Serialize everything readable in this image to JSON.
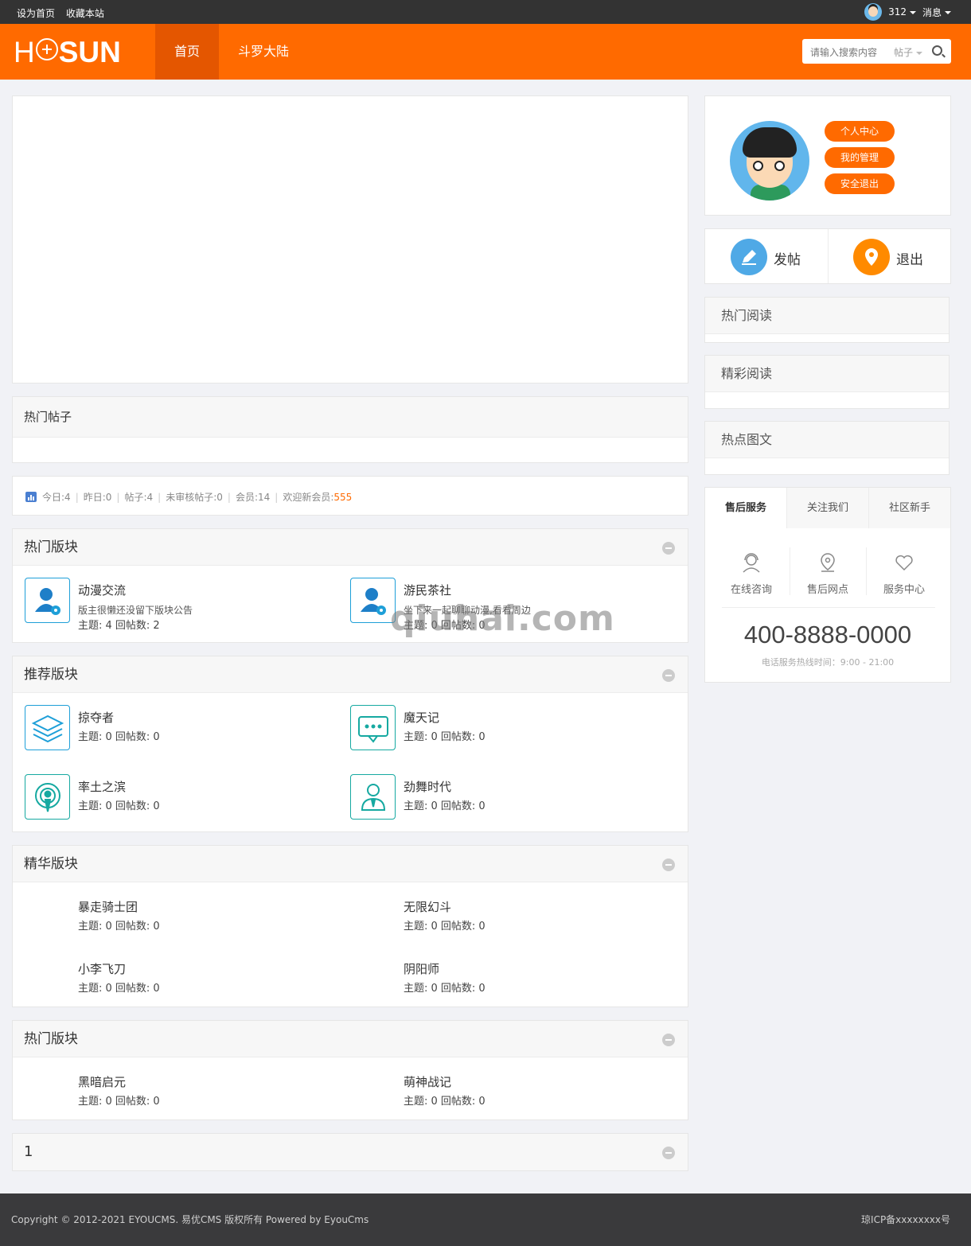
{
  "topbar": {
    "set_home": "设为首页",
    "bookmark": "收藏本站",
    "points": "312",
    "messages": "消息"
  },
  "header": {
    "logo_left": "H",
    "logo_right": "SUN",
    "nav": [
      "首页",
      "斗罗大陆"
    ],
    "search_placeholder": "请输入搜索内容",
    "search_type": "帖子"
  },
  "main": {
    "hot_posts_title": "热门帖子",
    "stats": {
      "today_label": "今日:",
      "today": "4",
      "yesterday_label": "昨日:",
      "yesterday": "0",
      "posts_label": "帖子:",
      "posts": "4",
      "pending_label": "未审核帖子:",
      "pending": "0",
      "members_label": "会员:",
      "members": "14",
      "welcome_label": "欢迎新会员:",
      "welcome_user": "555"
    },
    "sections": [
      {
        "title": "热门版块",
        "forums": [
          {
            "name": "动漫交流",
            "desc": "版主很懒还没留下版块公告",
            "stat": "主题: 4 回帖数: 2"
          },
          {
            "name": "游民茶社",
            "desc": "坐下来一起聊聊动漫,看看周边",
            "stat": "主题: 0 回帖数: 0"
          }
        ]
      },
      {
        "title": "推荐版块",
        "forums": [
          {
            "name": "掠夺者",
            "stat": "主题: 0 回帖数: 0"
          },
          {
            "name": "魔天记",
            "stat": "主题: 0 回帖数: 0"
          },
          {
            "name": "率土之滨",
            "stat": "主题: 0 回帖数: 0"
          },
          {
            "name": "劲舞时代",
            "stat": "主题: 0 回帖数: 0"
          }
        ]
      },
      {
        "title": "精华版块",
        "forums": [
          {
            "name": "暴走骑士团",
            "stat": "主题: 0 回帖数: 0"
          },
          {
            "name": "无限幻斗",
            "stat": "主题: 0 回帖数: 0"
          },
          {
            "name": "小李飞刀",
            "stat": "主题: 0 回帖数: 0"
          },
          {
            "name": "阴阳师",
            "stat": "主题: 0 回帖数: 0"
          }
        ]
      },
      {
        "title": "热门版块",
        "forums": [
          {
            "name": "黑暗启元",
            "stat": "主题: 0 回帖数: 0"
          },
          {
            "name": "萌神战记",
            "stat": "主题: 0 回帖数: 0"
          }
        ]
      },
      {
        "title": "1",
        "forums": []
      }
    ]
  },
  "sidebar": {
    "profile_buttons": [
      "个人中心",
      "我的管理",
      "安全退出"
    ],
    "post_label": "发帖",
    "logout_label": "退出",
    "hot_read": "热门阅读",
    "featured_read": "精彩阅读",
    "hot_pics": "热点图文",
    "service_tabs": [
      "售后服务",
      "关注我们",
      "社区新手"
    ],
    "service_items": [
      "在线咨询",
      "售后网点",
      "服务中心"
    ],
    "phone": "400-8888-0000",
    "phone_hint": "电话服务热线时间：9:00 - 21:00"
  },
  "footer": {
    "copyright": "Copyright © 2012-2021 EYOUCMS. 易优CMS 版权所有 Powered by EyouCms",
    "icp": "琼ICP备xxxxxxxx号"
  },
  "watermark": "qiuhai.com",
  "colors": {
    "accent": "#ff6a00",
    "nav_active": "#e45600",
    "icon_blue": "#1e9fd8",
    "icon_teal": "#16a9a1"
  }
}
